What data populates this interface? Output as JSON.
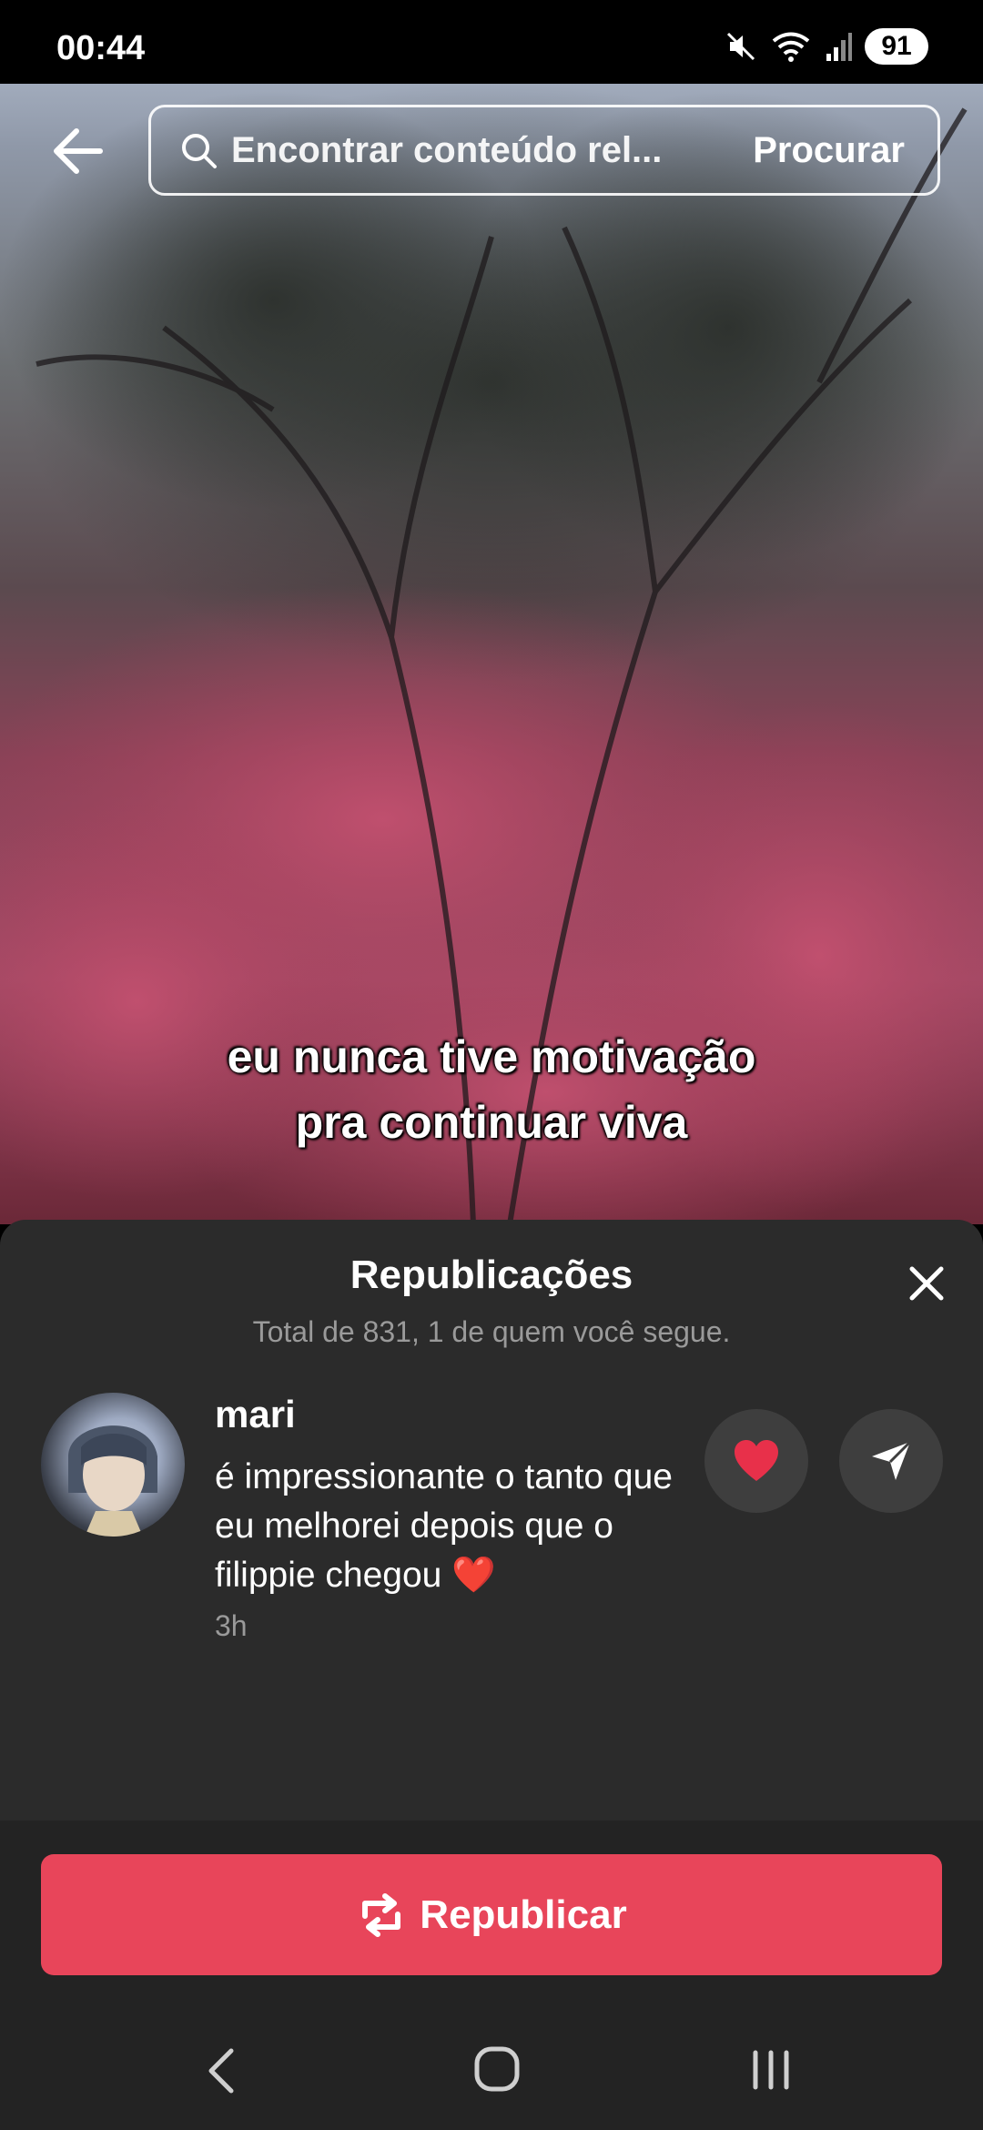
{
  "status_bar": {
    "time": "00:44",
    "battery": "91",
    "icons": [
      "mute-icon",
      "wifi-icon",
      "signal-icon"
    ]
  },
  "header": {
    "search_placeholder": "Encontrar conteúdo rel...",
    "search_button": "Procurar"
  },
  "video": {
    "caption_lines": [
      "eu nunca tive motivação",
      "pra continuar viva"
    ]
  },
  "sheet": {
    "title": "Republicações",
    "subtitle": "Total de 831, 1 de quem você segue.",
    "reposts": [
      {
        "username": "mari",
        "text": "é impressionante o tanto que eu melhorei depois que o filippie chegou ❤️",
        "time": "3h"
      }
    ]
  },
  "footer": {
    "repost_button": "Republicar"
  },
  "colors": {
    "accent": "#e8455a",
    "sheet_bg": "#2b2b2b",
    "secondary_text": "#9a9a9a"
  }
}
